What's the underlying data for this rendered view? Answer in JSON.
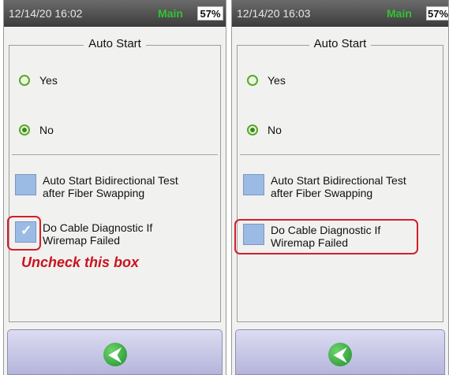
{
  "screens": [
    {
      "time": "12/14/20 16:02",
      "mode": "Main",
      "battery": "57%",
      "title": "Auto Start",
      "options": [
        "Yes",
        "No"
      ],
      "selected_option": "No",
      "checkboxes": [
        {
          "label_line1": "Auto Start Bidirectional Test",
          "label_line2": "after Fiber Swapping",
          "checked": false
        },
        {
          "label_line1": "Do Cable Diagnostic If",
          "label_line2": "Wiremap Failed",
          "checked": true
        }
      ],
      "annotation": "Uncheck this box"
    },
    {
      "time": "12/14/20 16:03",
      "mode": "Main",
      "battery": "57%",
      "title": "Auto Start",
      "options": [
        "Yes",
        "No"
      ],
      "selected_option": "No",
      "checkboxes": [
        {
          "label_line1": "Auto Start Bidirectional Test",
          "label_line2": "after Fiber Swapping",
          "checked": false
        },
        {
          "label_line1": "Do Cable Diagnostic If",
          "label_line2": "Wiremap Failed",
          "checked": false
        }
      ]
    }
  ],
  "icons": {
    "back": "back-arrow-icon"
  },
  "colors": {
    "mode_text": "#33c233",
    "highlight": "#d21f2a",
    "checkbox": "#9bbbe4",
    "radio": "#5aa72c"
  }
}
